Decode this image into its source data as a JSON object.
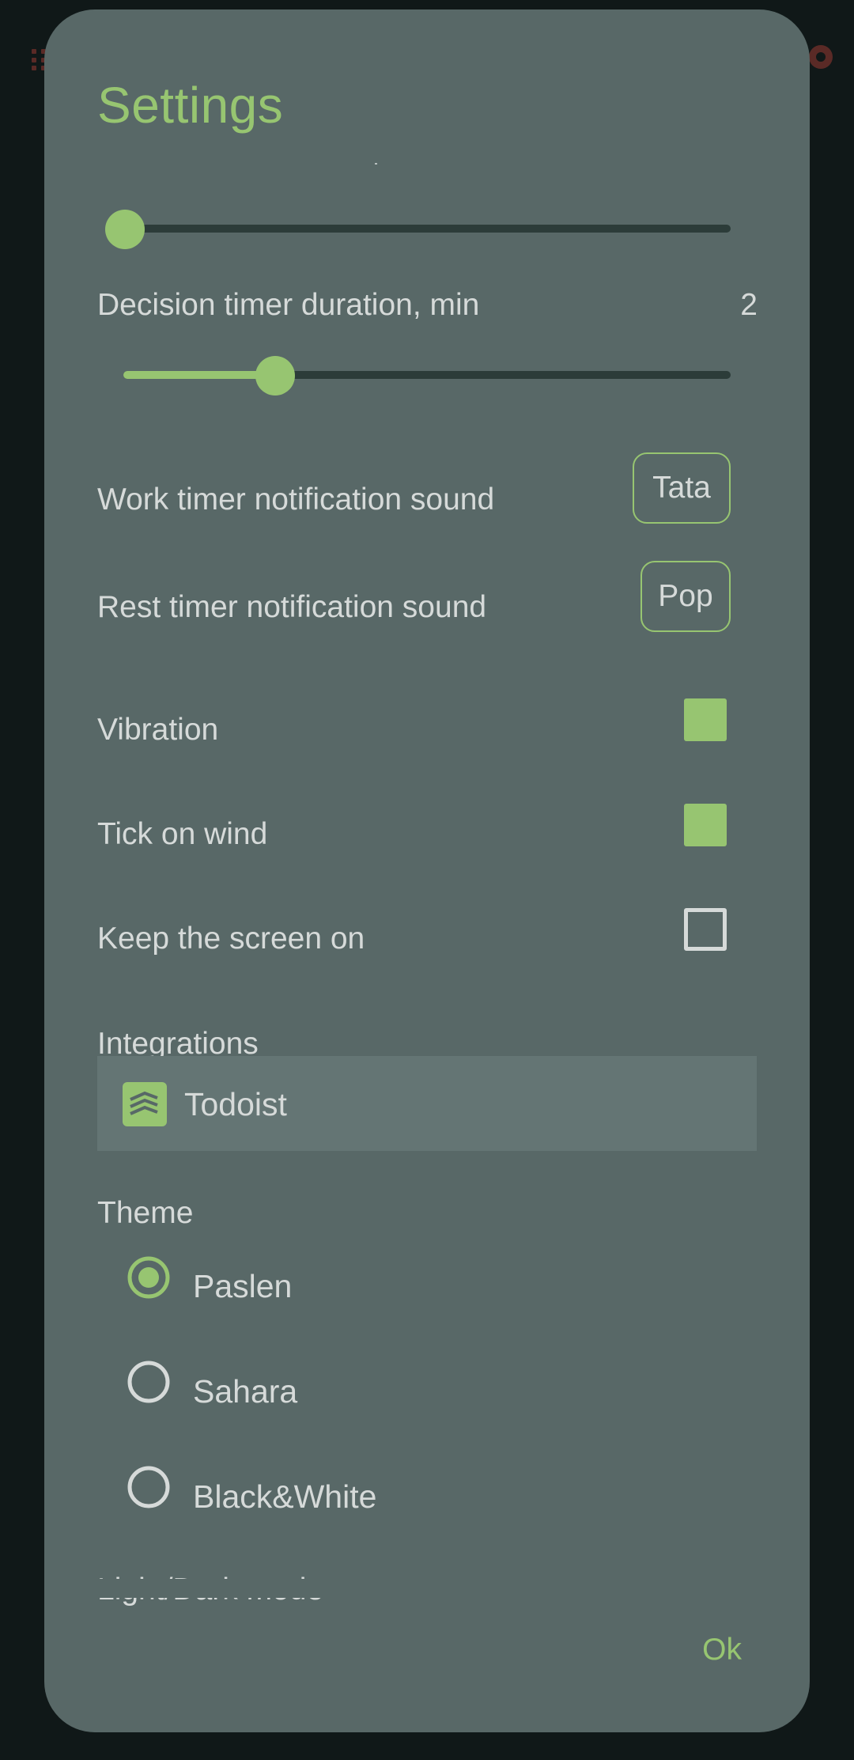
{
  "colors": {
    "accent": "#97c571",
    "dialog_bg": "#586867",
    "text": "#d6dad9",
    "track": "#2c3c39",
    "backdrop": "#101818"
  },
  "dialog": {
    "title": "Settings",
    "top_slider": {
      "fraction": 0.0
    },
    "decision_timer": {
      "label": "Decision timer duration, min",
      "value": "2",
      "fraction": 0.25
    },
    "work_sound": {
      "label": "Work timer notification sound",
      "button": "Tata"
    },
    "rest_sound": {
      "label": "Rest timer notification sound",
      "button": "Pop"
    },
    "vibration": {
      "label": "Vibration",
      "checked": true
    },
    "tick_on_wind": {
      "label": "Tick on wind",
      "checked": true
    },
    "keep_screen_on": {
      "label": "Keep the screen on",
      "checked": false
    },
    "integrations": {
      "heading": "Integrations",
      "items": [
        {
          "label": "Todoist",
          "icon": "todoist-icon"
        }
      ]
    },
    "theme": {
      "heading": "Theme",
      "options": [
        {
          "label": "Paslen",
          "selected": true
        },
        {
          "label": "Sahara",
          "selected": false
        },
        {
          "label": "Black&White",
          "selected": false
        }
      ]
    },
    "next_section_partial": "Light/Dark mode",
    "ok_label": "Ok"
  }
}
